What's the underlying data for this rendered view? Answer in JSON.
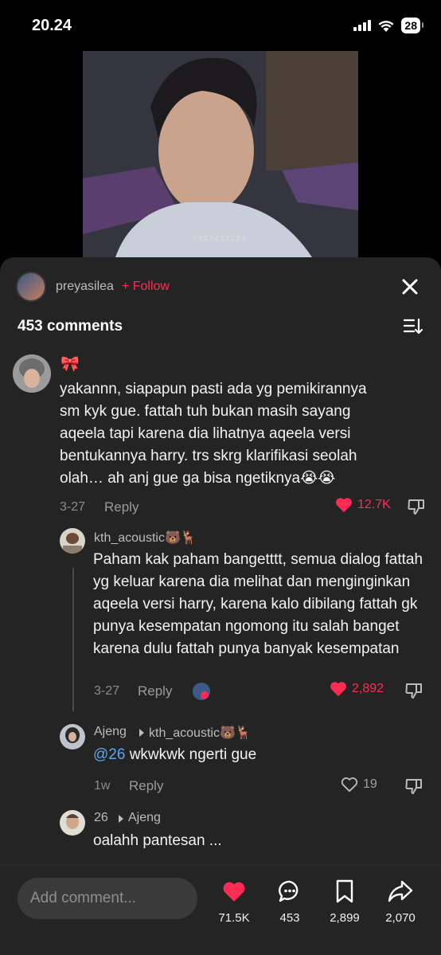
{
  "status": {
    "time": "20.24",
    "battery": "28"
  },
  "video": {
    "watermark": "PREYASILEA"
  },
  "header": {
    "author": "preyasilea",
    "follow": "+ Follow",
    "comments_title": "453 comments"
  },
  "comments": [
    {
      "username": "🎀",
      "text": "yakannn, siapapun pasti ada yg pemikirannya sm kyk gue. fattah tuh bukan masih sayang aqeela tapi karena dia lihatnya aqeela versi bentukannya harry. trs skrg klarifikasi seolah olah… ah anj gue ga bisa ngetiknya😭😭",
      "date": "3-27",
      "reply": "Reply",
      "likes": "12.7K",
      "liked": true
    }
  ],
  "replies": [
    {
      "username": "kth_acoustic🐻🦌",
      "text": "Paham kak paham bangetttt, semua dialog fattah yg keluar karena dia melihat dan menginginkan aqeela versi harry, karena kalo dibilang fattah gk punya kesempatan ngomong itu salah banget karena dulu fattah punya banyak kesempatan",
      "date": "3-27",
      "reply": "Reply",
      "likes": "2,892",
      "liked": true
    },
    {
      "username": "Ajeng",
      "reply_to": "kth_acoustic🐻🦌",
      "mention": "@26",
      "text": " wkwkwk ngerti gue",
      "date": "1w",
      "reply": "Reply",
      "likes": "19",
      "liked": false
    },
    {
      "username": "26",
      "reply_to": "Ajeng",
      "text": "oalahh pantesan ..."
    }
  ],
  "bottom": {
    "placeholder": "Add comment...",
    "likes": "71.5K",
    "comments": "453",
    "saves": "2,899",
    "shares": "2,070"
  },
  "colors": {
    "accent": "#fe2c55",
    "mention": "#5aa7f0",
    "sheet": "#242424"
  }
}
